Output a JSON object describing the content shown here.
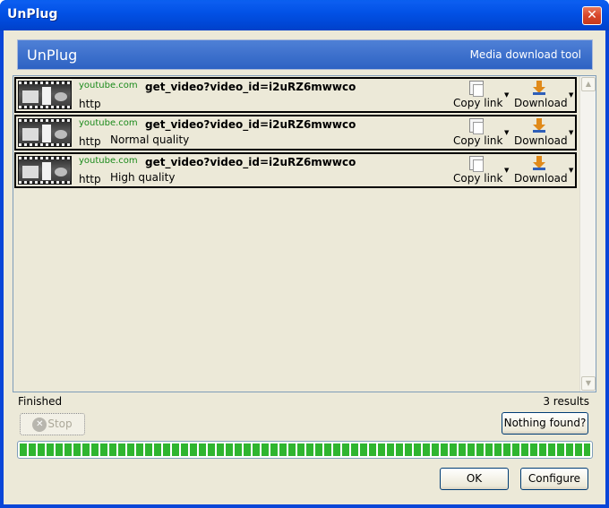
{
  "window": {
    "title": "UnPlug",
    "close_glyph": "✕"
  },
  "banner": {
    "title": "UnPlug",
    "subtitle": "Media download tool"
  },
  "results": [
    {
      "site": "youtube.com",
      "name": "get_video?video_id=i2uRZ6mwwco",
      "protocol": "http",
      "quality": "",
      "copy_label": "Copy link",
      "download_label": "Download"
    },
    {
      "site": "youtube.com",
      "name": "get_video?video_id=i2uRZ6mwwco",
      "protocol": "http",
      "quality": "Normal quality",
      "copy_label": "Copy link",
      "download_label": "Download"
    },
    {
      "site": "youtube.com",
      "name": "get_video?video_id=i2uRZ6mwwco",
      "protocol": "http",
      "quality": "High quality",
      "copy_label": "Copy link",
      "download_label": "Download"
    }
  ],
  "status": {
    "state": "Finished",
    "count": "3 results"
  },
  "buttons": {
    "stop": "Stop",
    "nothing_found": "Nothing found?",
    "ok": "OK",
    "configure": "Configure"
  },
  "progress": {
    "value": 1.0
  },
  "colors": {
    "title_bar": "#0a46d8",
    "banner": "#3a6cc8",
    "site_link": "#1a8a1a",
    "progress": "#2fb52f"
  },
  "icons": {
    "close": "close-icon",
    "copy": "copy-icon",
    "download": "download-icon",
    "stop": "stop-icon"
  }
}
